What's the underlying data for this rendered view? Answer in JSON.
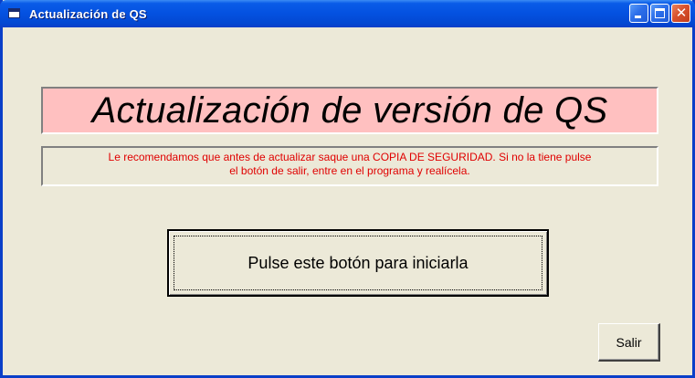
{
  "window": {
    "title": "Actualización de QS"
  },
  "banner": {
    "text": "Actualización de versión de QS",
    "background": "#FFC0C0"
  },
  "notice": {
    "line1": "Le recomendamos que antes de actualizar saque una COPIA DE SEGURIDAD. Si no la tiene pulse",
    "line2": "el botón de salir, entre en el programa y realícela.",
    "color": "#E00000"
  },
  "buttons": {
    "start_label": "Pulse este botón para iniciarla",
    "exit_label": "Salir"
  },
  "icons": {
    "app": "app-window-icon",
    "minimize": "minimize-icon",
    "maximize": "maximize-icon",
    "close": "close-icon"
  }
}
